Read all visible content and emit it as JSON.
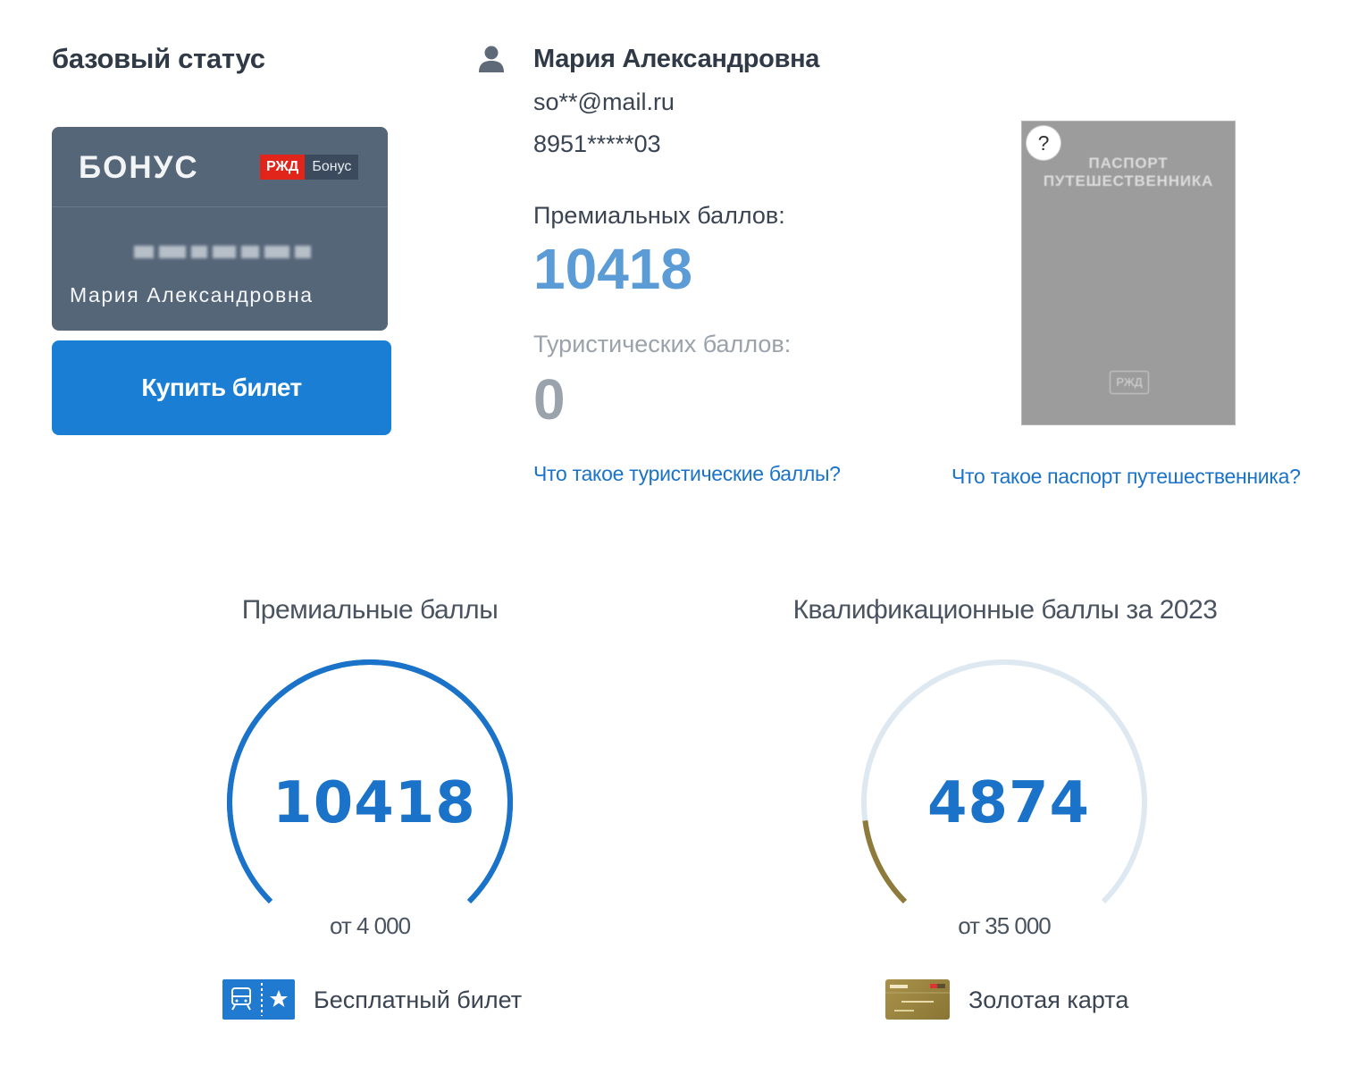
{
  "status": {
    "title": "базовый статус"
  },
  "card": {
    "brand": "БОНУС",
    "logo_rzd": "РЖД",
    "logo_bonus": "Бонус",
    "holder": "Мария Александровна"
  },
  "buy_button": {
    "label": "Купить билет"
  },
  "user": {
    "name": "Мария Александровна",
    "email": "so**@mail.ru",
    "phone": "8951*****03",
    "icon": "user-icon"
  },
  "points": {
    "premium_label": "Премиальных баллов:",
    "premium_value": "10418",
    "tourist_label": "Туристических баллов:",
    "tourist_value": "0",
    "tourist_link": "Что такое туристические баллы?"
  },
  "passport": {
    "title": "ПАСПОРТ ПУТЕШЕСТВЕННИКА",
    "logo": "РЖД",
    "help": "?",
    "link": "Что такое паспорт путешественника?"
  },
  "gauges": [
    {
      "title": "Премиальные баллы",
      "value": "10418",
      "threshold": "от 4 000",
      "progress": 1.0,
      "color": "#1a73c8",
      "track_color": "#1a73c8",
      "reward_label": "Бесплатный билет",
      "reward_icon": "free-ticket-icon"
    },
    {
      "title": "Квалификационные баллы за 2023",
      "value": "4874",
      "threshold": "от 35 000",
      "progress": 0.139,
      "color": "#8e7a3a",
      "track_color": "#dde8f1",
      "reward_label": "Золотая карта",
      "reward_icon": "gold-card-icon"
    }
  ],
  "colors": {
    "accent": "#1a7fd4",
    "link": "#1a73c8",
    "card_bg": "#566679",
    "premium_value": "#5b9bd6",
    "muted": "#9aa2ab"
  }
}
